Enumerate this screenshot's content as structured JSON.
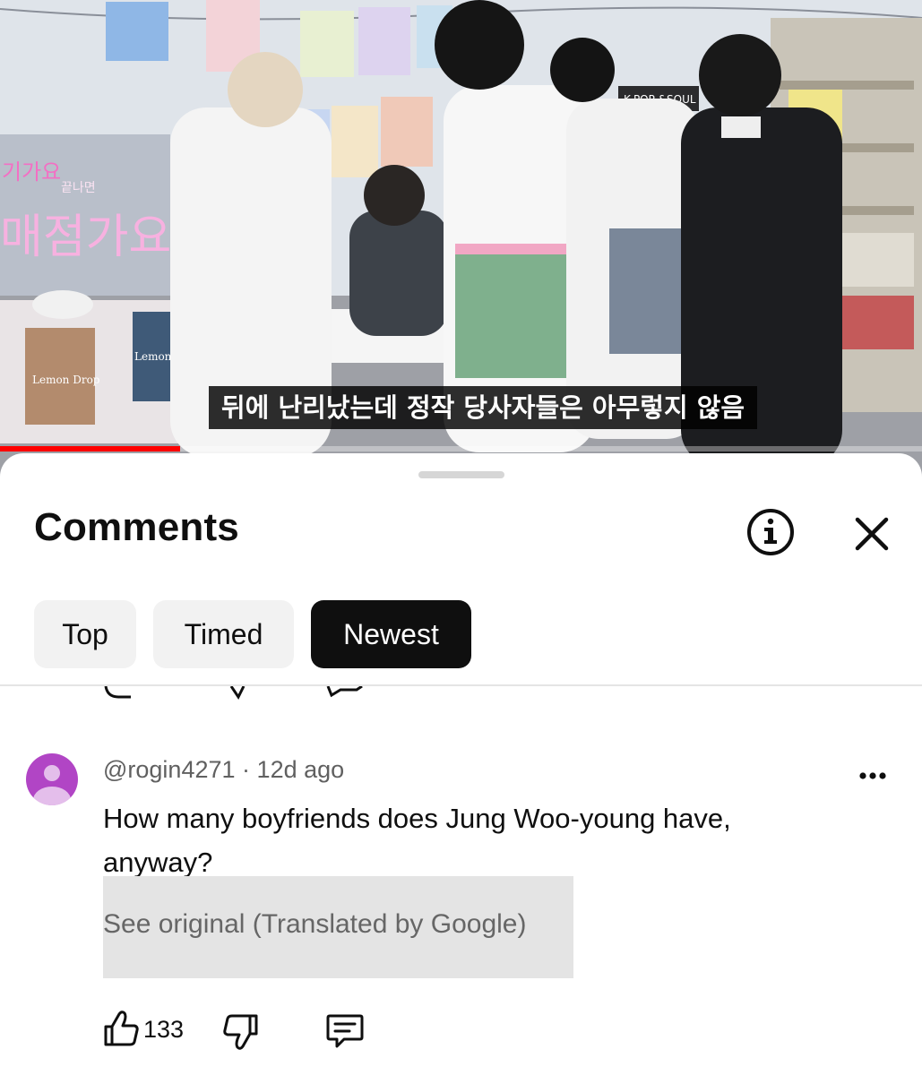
{
  "video": {
    "subtitle": "뒤에 난리났는데 정작 당사자들은 아무렇지 않음",
    "progress_percent": 19.5,
    "signage": {
      "kpop_sign": "K-POP &SOUL",
      "neon_sign": "매점가요",
      "neon_small": "끝나면",
      "neon_left": "기가요",
      "album_left": "Lemon Drop",
      "album_right": "Lemon Drop"
    },
    "colors": {
      "progress": "#ff0000"
    }
  },
  "comments_sheet": {
    "title": "Comments",
    "info_icon": "info-circle-icon",
    "close_icon": "close-x-icon",
    "filters": [
      {
        "label": "Top",
        "selected": false
      },
      {
        "label": "Timed",
        "selected": false
      },
      {
        "label": "Newest",
        "selected": true
      }
    ]
  },
  "comment": {
    "author": "@rogin4271",
    "separator": "·",
    "age": "12d ago",
    "text": "How many boyfriends does Jung Woo-young have, anyway?",
    "translate_link": "See original (Translated by Google)",
    "like_count": "133",
    "avatar_color": "#b145c5",
    "icons": {
      "more": "more-horizontal-icon",
      "like": "thumbs-up-icon",
      "dislike": "thumbs-down-icon",
      "reply": "reply-comment-icon"
    }
  }
}
